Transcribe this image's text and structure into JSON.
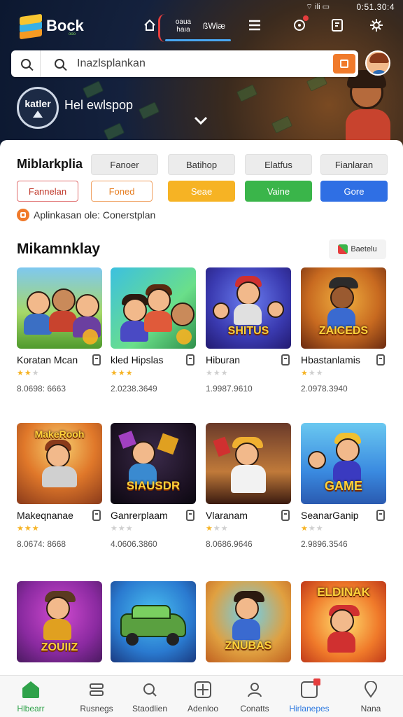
{
  "status_bar": {
    "time": "0:51.30:4",
    "icons": "⌔ ili ▭"
  },
  "app": {
    "brand": "Bock",
    "brand_sub": "ooo"
  },
  "top_nav": {
    "tab1": "oaua\nhaıa",
    "tab2": "ßWiæ",
    "icons": [
      "home-icon",
      "menu-icon",
      "notification-icon",
      "document-icon",
      "settings-icon"
    ]
  },
  "search": {
    "placeholder": "Inazlsplankan"
  },
  "hero": {
    "badge": "katler",
    "title": "Hel ewlspop"
  },
  "filters": {
    "heading": "Miblarkplia",
    "row1": [
      "Fanoer",
      "Batihop",
      "Elatfus",
      "Fianlaran"
    ],
    "row2": [
      "Fannelan",
      "Foned",
      "Seae",
      "Vaine",
      "Gore"
    ]
  },
  "info_line": "Aplinkasan ole: Conerstplan",
  "section": {
    "title": "Mikamnklay",
    "button": "Baetelu"
  },
  "games": [
    {
      "name": "Koratan Mcan",
      "stars": 2,
      "count": "8.0698: 6663",
      "logo": ""
    },
    {
      "name": "kled Hipslas",
      "stars": 3,
      "count": "2.0238.3649",
      "logo": ""
    },
    {
      "name": "Hiburan",
      "stars": 0,
      "count": "1.9987.9610",
      "logo": "SHITUS"
    },
    {
      "name": "Hbastanlamis",
      "stars": 1,
      "count": "2.0978.3940",
      "logo": "ZAICEDS"
    },
    {
      "name": "Makeqnanae",
      "stars": 3,
      "count": "8.0674: 8668",
      "logo": "MakeRooh"
    },
    {
      "name": "Ganrerplaam",
      "stars": 0,
      "count": "4.0606.3860",
      "logo": "SIAUSDR"
    },
    {
      "name": "Vlaranam",
      "stars": 1,
      "count": "8.0686.9646",
      "logo": ""
    },
    {
      "name": "SeanarGanip",
      "stars": 1,
      "count": "2.9896.3546",
      "logo": "GAME"
    },
    {
      "name": "",
      "stars": 0,
      "count": "",
      "logo": "ZOUIIZ"
    },
    {
      "name": "",
      "stars": 0,
      "count": "",
      "logo": ""
    },
    {
      "name": "",
      "stars": 0,
      "count": "",
      "logo": "ZNUBAS"
    },
    {
      "name": "",
      "stars": 0,
      "count": "",
      "logo": "ELDINAK"
    }
  ],
  "bottom_nav": [
    "Hlbearr",
    "Rusnegs",
    "Staodlien",
    "Adenloo",
    "Conatts",
    "Hirlanepes",
    "Nana"
  ],
  "colors": {
    "accent_orange": "#f07a2b",
    "nav_active": "#2fa24a",
    "nav_highlight": "#49a7f2"
  }
}
